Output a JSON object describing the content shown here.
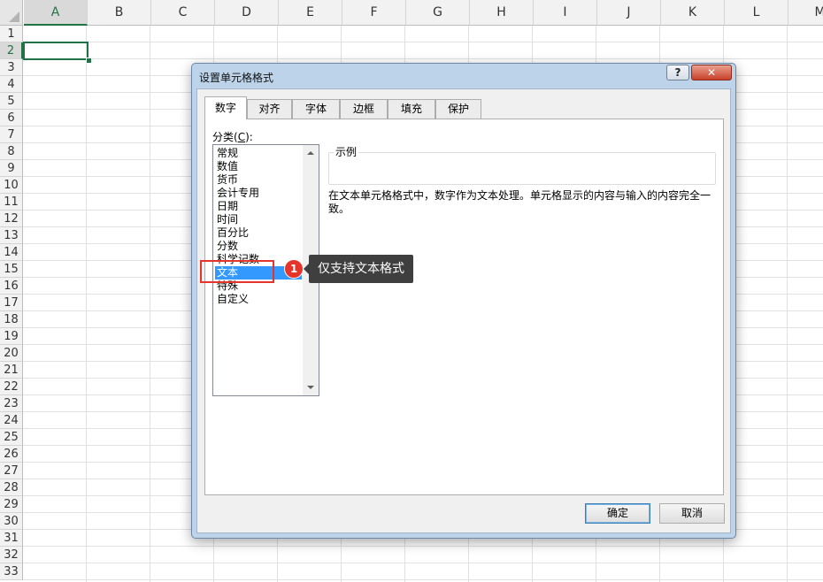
{
  "sheet": {
    "columns": [
      "A",
      "B",
      "C",
      "D",
      "E",
      "F",
      "G",
      "H",
      "I",
      "J",
      "K",
      "L",
      "M"
    ],
    "rows": [
      "1",
      "2",
      "3",
      "4",
      "5",
      "6",
      "7",
      "8",
      "9",
      "10",
      "11",
      "12",
      "13",
      "14",
      "15",
      "16",
      "17",
      "18",
      "19",
      "20",
      "21",
      "22",
      "23",
      "24",
      "25",
      "26",
      "27",
      "28",
      "29",
      "30",
      "31",
      "32",
      "33"
    ],
    "active_column": "A",
    "active_row": "2"
  },
  "dialog": {
    "title": "设置单元格格式",
    "help_label": "?",
    "close_label": "✕",
    "tabs": [
      {
        "label": "数字",
        "selected": true
      },
      {
        "label": "对齐"
      },
      {
        "label": "字体"
      },
      {
        "label": "边框"
      },
      {
        "label": "填充"
      },
      {
        "label": "保护"
      }
    ],
    "category_label_prefix": "分类(",
    "category_label_key": "C",
    "category_label_suffix": "):",
    "categories": [
      "常规",
      "数值",
      "货币",
      "会计专用",
      "日期",
      "时间",
      "百分比",
      "分数",
      "科学记数",
      "文本",
      "特殊",
      "自定义"
    ],
    "selected_category": "文本",
    "sample_label": "示例",
    "description": "在文本单元格格式中，数字作为文本处理。单元格显示的内容与输入的内容完全一致。",
    "ok_label": "确定",
    "cancel_label": "取消"
  },
  "annotation": {
    "badge": "1",
    "text": "仅支持文本格式",
    "color": "#e5352b"
  },
  "colors": {
    "excel_green": "#217346",
    "selection_blue": "#3399ff",
    "dialog_frame": "#bcd3ea"
  }
}
